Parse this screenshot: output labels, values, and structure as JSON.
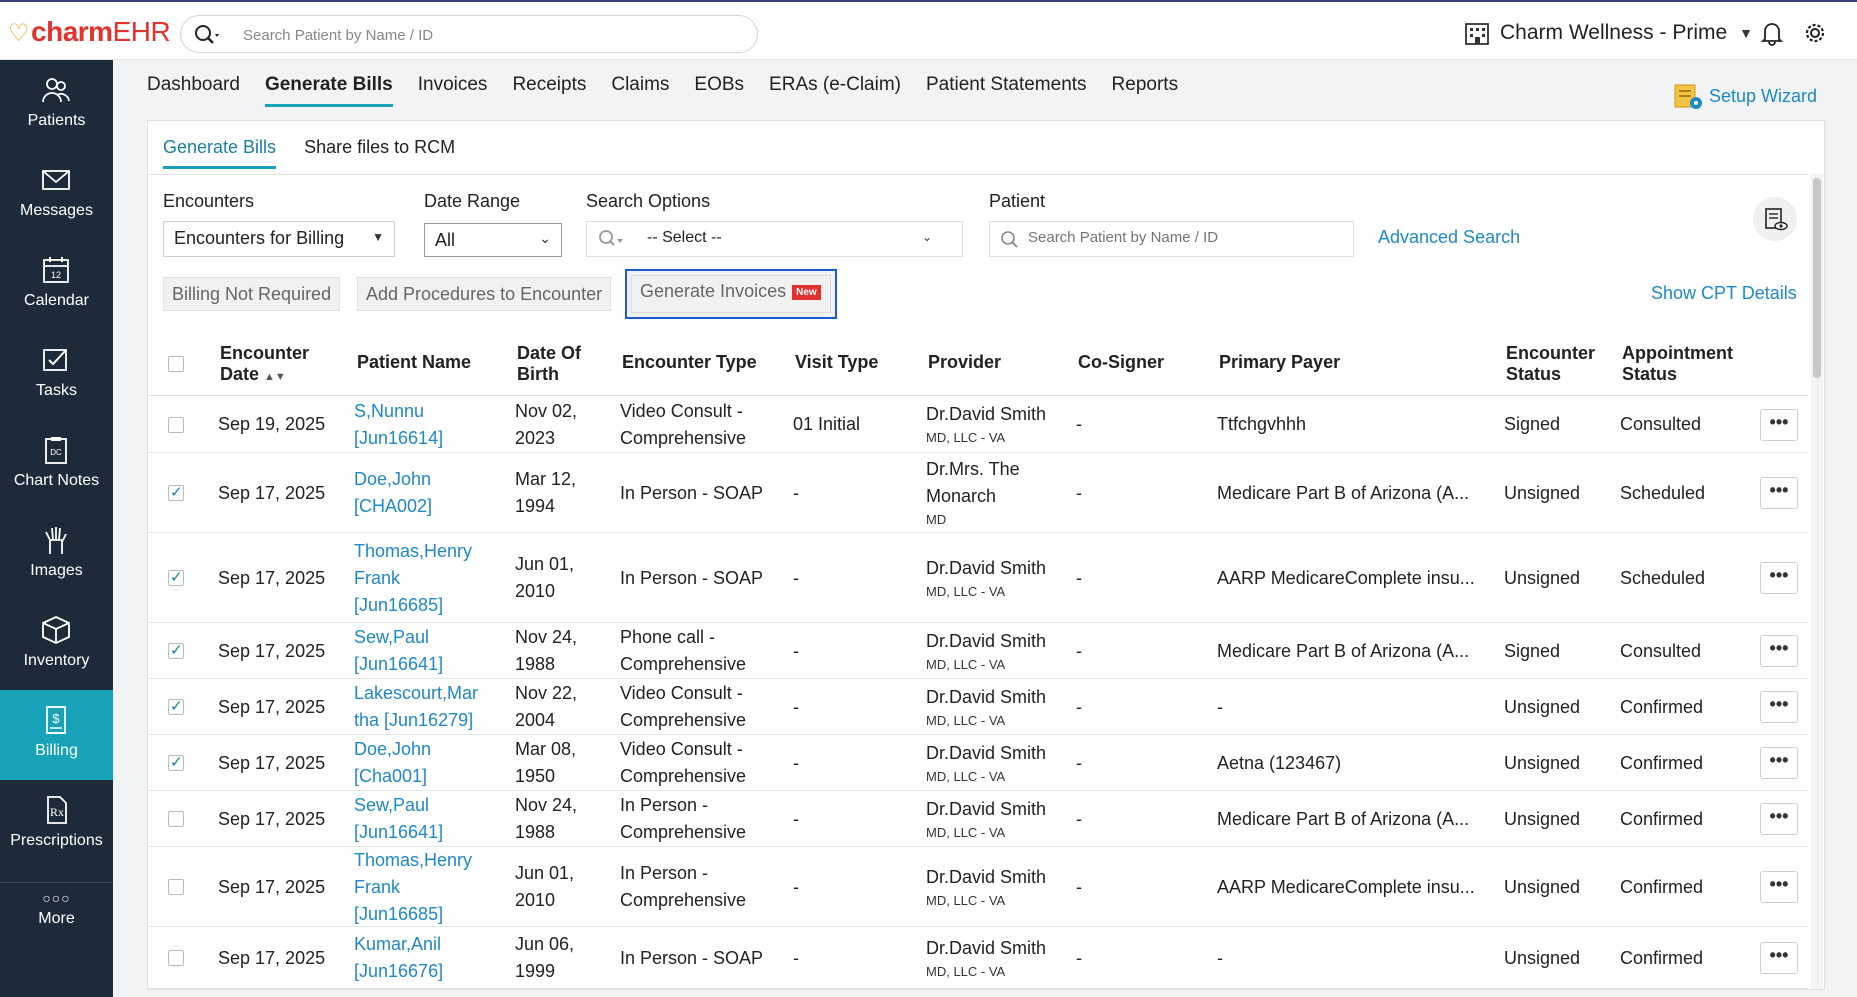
{
  "app": {
    "logo_primary": "charm",
    "logo_secondary": "EHR"
  },
  "top_search": {
    "placeholder": "Search Patient by Name / ID"
  },
  "clinic": {
    "name": "Charm Wellness - Prime"
  },
  "sidebar": {
    "items": [
      {
        "label": "Patients",
        "icon": "patients-icon"
      },
      {
        "label": "Messages",
        "icon": "envelope-icon"
      },
      {
        "label": "Calendar",
        "icon": "calendar-icon"
      },
      {
        "label": "Tasks",
        "icon": "tasks-icon"
      },
      {
        "label": "Chart Notes",
        "icon": "chart-notes-icon"
      },
      {
        "label": "Images",
        "icon": "xray-icon"
      },
      {
        "label": "Inventory",
        "icon": "box-icon"
      },
      {
        "label": "Billing",
        "icon": "billing-icon"
      },
      {
        "label": "Prescriptions",
        "icon": "rx-icon"
      },
      {
        "label": "More",
        "icon": "more-icon"
      }
    ],
    "active": "Billing"
  },
  "main_tabs": [
    "Dashboard",
    "Generate Bills",
    "Invoices",
    "Receipts",
    "Claims",
    "EOBs",
    "ERAs (e-Claim)",
    "Patient Statements",
    "Reports"
  ],
  "setup_wizard": "Setup Wizard",
  "sub_tabs": [
    "Generate Bills",
    "Share files to RCM"
  ],
  "filters": {
    "encounters_label": "Encounters",
    "encounters_value": "Encounters for Billing",
    "date_range_label": "Date Range",
    "date_range_value": "All",
    "search_options_label": "Search Options",
    "search_options_value": "-- Select --",
    "patient_label": "Patient",
    "patient_placeholder": "Search Patient by Name / ID",
    "advanced_search": "Advanced Search"
  },
  "actions": {
    "billing_not_required": "Billing Not Required",
    "add_procedures": "Add Procedures to Encounter",
    "generate_invoices": "Generate Invoices",
    "new_badge": "New",
    "show_cpt": "Show CPT Details"
  },
  "table": {
    "headers": {
      "encounter_date": "Encounter Date",
      "patient_name": "Patient Name",
      "dob": "Date Of Birth",
      "encounter_type": "Encounter Type",
      "visit_type": "Visit Type",
      "provider": "Provider",
      "cosigner": "Co-Signer",
      "primary_payer": "Primary Payer",
      "encounter_status": "Encounter Status",
      "appointment_status": "Appointment Status"
    },
    "rows": [
      {
        "checked": false,
        "date": "Sep 19, 2025",
        "patient": [
          "S,Nunnu",
          "[Jun16614]"
        ],
        "dob": [
          "Nov 02,",
          "2023"
        ],
        "type": [
          "Video Consult -",
          "Comprehensive"
        ],
        "visit": "01 Initial",
        "provider": "Dr.David Smith",
        "provider_sub": "MD, LLC - VA",
        "cosigner": "-",
        "payer": "Ttfchgvhhh",
        "enc_status": "Signed",
        "appt_status": "Consulted"
      },
      {
        "checked": true,
        "date": "Sep 17, 2025",
        "patient": [
          "Doe,John",
          "[CHA002]"
        ],
        "dob": [
          "Mar 12,",
          "1994"
        ],
        "type": [
          "In Person - SOAP"
        ],
        "visit": "-",
        "provider": "Dr.Mrs. The",
        "provider2": "Monarch",
        "provider_sub": "MD",
        "cosigner": "-",
        "payer": "Medicare Part B of Arizona (A...",
        "enc_status": "Unsigned",
        "appt_status": "Scheduled"
      },
      {
        "checked": true,
        "date": "Sep 17, 2025",
        "patient": [
          "Thomas,Henry",
          "Frank",
          "[Jun16685]"
        ],
        "dob": [
          "Jun 01,",
          "2010"
        ],
        "type": [
          "In Person - SOAP"
        ],
        "visit": "-",
        "provider": "Dr.David Smith",
        "provider_sub": "MD, LLC - VA",
        "cosigner": "-",
        "payer": "AARP MedicareComplete insu...",
        "enc_status": "Unsigned",
        "appt_status": "Scheduled"
      },
      {
        "checked": true,
        "date": "Sep 17, 2025",
        "patient": [
          "Sew,Paul",
          "[Jun16641]"
        ],
        "dob": [
          "Nov 24,",
          "1988"
        ],
        "type": [
          "Phone call -",
          "Comprehensive"
        ],
        "visit": "-",
        "provider": "Dr.David Smith",
        "provider_sub": "MD, LLC - VA",
        "cosigner": "-",
        "payer": "Medicare Part B of Arizona (A...",
        "enc_status": "Signed",
        "appt_status": "Consulted"
      },
      {
        "checked": true,
        "date": "Sep 17, 2025",
        "patient": [
          "Lakescourt,Mar",
          "tha [Jun16279]"
        ],
        "dob": [
          "Nov 22,",
          "2004"
        ],
        "type": [
          "Video Consult -",
          "Comprehensive"
        ],
        "visit": "-",
        "provider": "Dr.David Smith",
        "provider_sub": "MD, LLC - VA",
        "cosigner": "-",
        "payer": "-",
        "enc_status": "Unsigned",
        "appt_status": "Confirmed"
      },
      {
        "checked": true,
        "date": "Sep 17, 2025",
        "patient": [
          "Doe,John",
          "[Cha001]"
        ],
        "dob": [
          "Mar 08,",
          "1950"
        ],
        "type": [
          "Video Consult -",
          "Comprehensive"
        ],
        "visit": "-",
        "provider": "Dr.David Smith",
        "provider_sub": "MD, LLC - VA",
        "cosigner": "-",
        "payer": "Aetna (123467)",
        "enc_status": "Unsigned",
        "appt_status": "Confirmed"
      },
      {
        "checked": false,
        "date": "Sep 17, 2025",
        "patient": [
          "Sew,Paul",
          "[Jun16641]"
        ],
        "dob": [
          "Nov 24,",
          "1988"
        ],
        "type": [
          "In Person -",
          "Comprehensive"
        ],
        "visit": "-",
        "provider": "Dr.David Smith",
        "provider_sub": "MD, LLC - VA",
        "cosigner": "-",
        "payer": "Medicare Part B of Arizona (A...",
        "enc_status": "Unsigned",
        "appt_status": "Confirmed"
      },
      {
        "checked": false,
        "date": "Sep 17, 2025",
        "patient": [
          "Thomas,Henry",
          "Frank",
          "[Jun16685]"
        ],
        "dob": [
          "Jun 01,",
          "2010"
        ],
        "type": [
          "In Person -",
          "Comprehensive"
        ],
        "visit": "-",
        "provider": "Dr.David Smith",
        "provider_sub": "MD, LLC - VA",
        "cosigner": "-",
        "payer": "AARP MedicareComplete insu...",
        "enc_status": "Unsigned",
        "appt_status": "Confirmed"
      },
      {
        "checked": false,
        "date": "Sep 17, 2025",
        "patient": [
          "Kumar,Anil",
          "[Jun16676]"
        ],
        "dob": [
          "Jun 06,",
          "1999"
        ],
        "type": [
          "In Person - SOAP"
        ],
        "visit": "-",
        "provider": "Dr.David Smith",
        "provider_sub": "MD, LLC - VA",
        "cosigner": "-",
        "payer": "-",
        "enc_status": "Unsigned",
        "appt_status": "Confirmed"
      }
    ]
  }
}
